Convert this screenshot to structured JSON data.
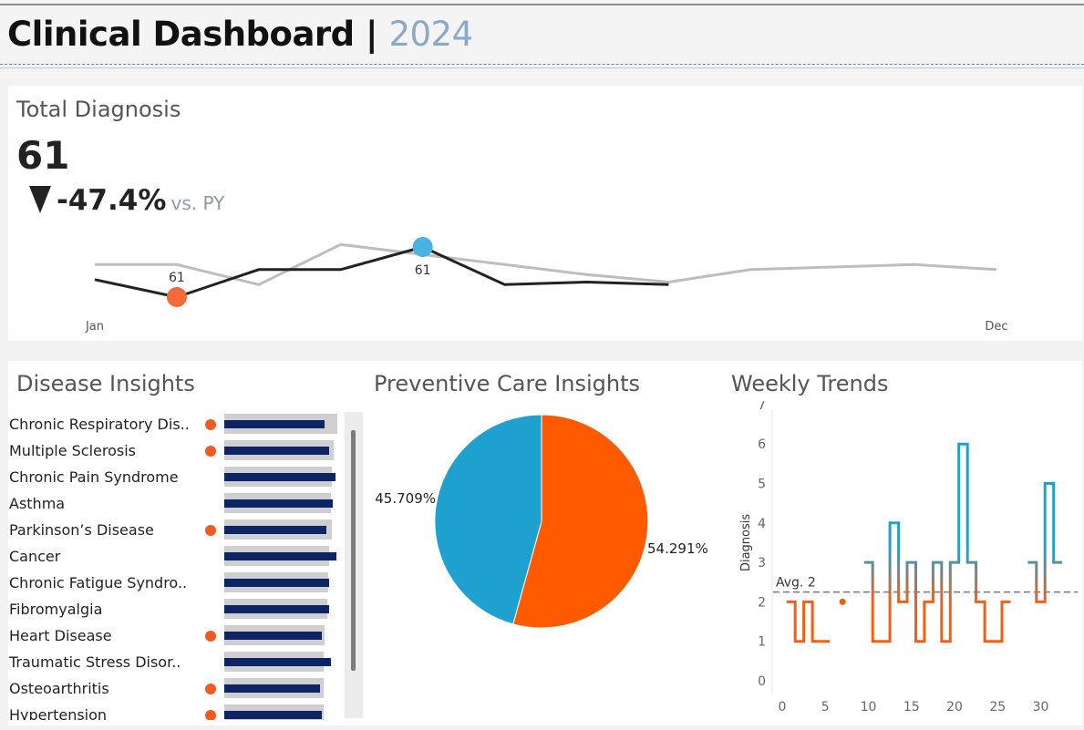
{
  "header": {
    "title": "Clinical Dashboard",
    "separator": "|",
    "year": "2024"
  },
  "kpi": {
    "title": "Total Diagnosis",
    "value": "61",
    "delta": "-47.4%",
    "delta_label": "vs. PY"
  },
  "disease": {
    "title": "Disease Insights",
    "items": [
      {
        "label": "Chronic Respiratory Dis..",
        "flag": true,
        "actual": 8.9,
        "target": 10
      },
      {
        "label": "Multiple Sclerosis",
        "flag": true,
        "actual": 9.3,
        "target": 9.7
      },
      {
        "label": "Chronic Pain Syndrome",
        "flag": false,
        "actual": 9.8,
        "target": 9.5
      },
      {
        "label": "Asthma",
        "flag": false,
        "actual": 9.6,
        "target": 9.4
      },
      {
        "label": "Parkinson’s Disease",
        "flag": true,
        "actual": 9.0,
        "target": 9.5
      },
      {
        "label": "Cancer",
        "flag": false,
        "actual": 9.9,
        "target": 9.3
      },
      {
        "label": "Chronic Fatigue Syndro..",
        "flag": false,
        "actual": 9.3,
        "target": 9.2
      },
      {
        "label": "Fibromyalgia",
        "flag": false,
        "actual": 9.3,
        "target": 9.1
      },
      {
        "label": "Heart Disease",
        "flag": true,
        "actual": 8.6,
        "target": 8.9
      },
      {
        "label": "Traumatic Stress Disor..",
        "flag": false,
        "actual": 9.4,
        "target": 8.8
      },
      {
        "label": "Osteoarthritis",
        "flag": true,
        "actual": 8.5,
        "target": 8.8
      },
      {
        "label": "Hypertension",
        "flag": true,
        "actual": 8.6,
        "target": 8.8
      }
    ]
  },
  "colors": {
    "navy": "#0e2564",
    "orange": "#ff5a00",
    "blue": "#1fa1d0",
    "gray_line": "#bdbdbd"
  },
  "chart_data": [
    {
      "type": "line",
      "x": [
        "Jan",
        "Feb",
        "Mar",
        "Apr",
        "May",
        "Jun",
        "Jul",
        "Aug",
        "Sep",
        "Oct",
        "Nov",
        "Dec"
      ],
      "x_tick_labels": [
        "Jan",
        "Dec"
      ],
      "series": [
        {
          "values": [
            54,
            54,
            46,
            62,
            58,
            54,
            50,
            47,
            52,
            53,
            54,
            52
          ],
          "color": "#bdbdbd"
        },
        {
          "values": [
            48,
            41,
            52,
            52,
            61,
            46,
            47,
            46,
            null,
            null,
            null,
            null
          ],
          "color": "#222222"
        }
      ],
      "annotations": [
        {
          "x": "Feb",
          "value": 61,
          "label": "61",
          "color": "#f46a3a"
        },
        {
          "x": "May",
          "value": 61,
          "label": "61",
          "color": "#4ab2e0"
        }
      ]
    },
    {
      "type": "pie",
      "title": "Preventive Care Insights",
      "values": [
        54.291,
        45.709
      ],
      "labels": [
        "54.291%",
        "45.709%"
      ],
      "colors": [
        "#ff5a00",
        "#1fa1d0"
      ]
    },
    {
      "type": "line",
      "title": "Weekly Trends",
      "ylabel": "Diagnosis",
      "xlim": [
        -1,
        34
      ],
      "ylim": [
        0,
        7
      ],
      "xticks": [
        0,
        5,
        10,
        15,
        20,
        25,
        30
      ],
      "yticks": [
        0,
        1,
        2,
        3,
        4,
        5,
        6,
        7
      ],
      "avg": {
        "value": 2.25,
        "label": "Avg. 2"
      },
      "step_series": [
        {
          "x": [
            1,
            2,
            3,
            4,
            5
          ],
          "y": [
            2,
            1,
            2,
            1,
            1
          ]
        },
        {
          "x": [
            7
          ],
          "y": [
            2
          ]
        },
        {
          "x": [
            10,
            11,
            12,
            13,
            14,
            15,
            16,
            17,
            18,
            19,
            20,
            21,
            22,
            23,
            24,
            25,
            26
          ],
          "y": [
            3,
            1,
            1,
            4,
            2,
            3,
            1,
            2,
            3,
            1,
            3,
            6,
            3,
            2,
            1,
            1,
            2
          ]
        },
        {
          "x": [
            29,
            30,
            31,
            32
          ],
          "y": [
            3,
            2,
            5,
            3
          ]
        }
      ]
    }
  ]
}
